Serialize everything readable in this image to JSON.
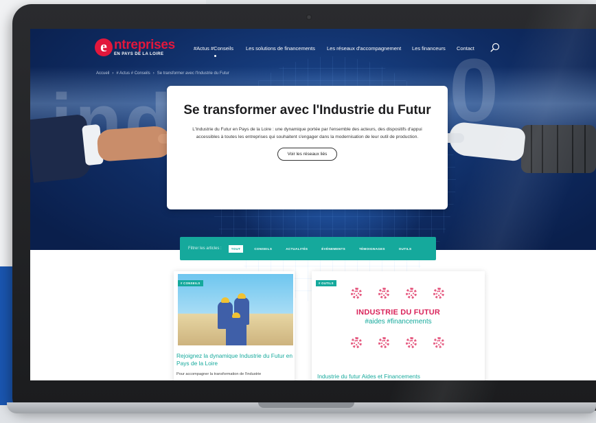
{
  "site": {
    "logo": {
      "letter": "e",
      "title": "ntreprises",
      "subtitle": "EN PAYS DE LA LOIRE"
    },
    "nav": [
      "#Actus #Conseils",
      "Les solutions de financements",
      "Les réseaux d'accompagnement",
      "Les financeurs",
      "Contact"
    ],
    "breadcrumb": [
      "Accueil",
      "# Actus # Conseils",
      "Se transformer avec l'Industrie du Futur"
    ]
  },
  "hero": {
    "bg_text_1": "indu",
    "bg_text_2": "0",
    "title": "Se transformer avec l'Industrie du Futur",
    "text": "L'Industrie du Futur en Pays de la Loire : une dynamique portée par l'ensemble des acteurs, des dispositifs d'appui accessibles à toutes les entreprises qui souhaitent s'engager dans la modernisation de leur outil de production.",
    "cta": "Voir les réseaux liés"
  },
  "filters": {
    "label": "Filtrer les articles :",
    "chips": [
      "TOUT",
      "CONSEILS",
      "ACTUALITÉS",
      "ÉVÉNEMENTS",
      "TÉMOIGNAGES",
      "OUTILS"
    ],
    "active_index": 0
  },
  "cards": [
    {
      "tag": "# CONSEILS",
      "title": "Rejoignez la dynamique Industrie du Futur en Pays de la Loire",
      "excerpt": "Pour accompagner la transformation de l'industrie"
    },
    {
      "tag": "# OUTILS",
      "image_heading": "INDUSTRIE DU FUTUR",
      "image_subheading": "#aides #financements",
      "title": "Industrie du futur Aides et Financements"
    }
  ],
  "colors": {
    "brand_red": "#e2173c",
    "teal": "#15a99c",
    "pink": "#d9235a"
  }
}
